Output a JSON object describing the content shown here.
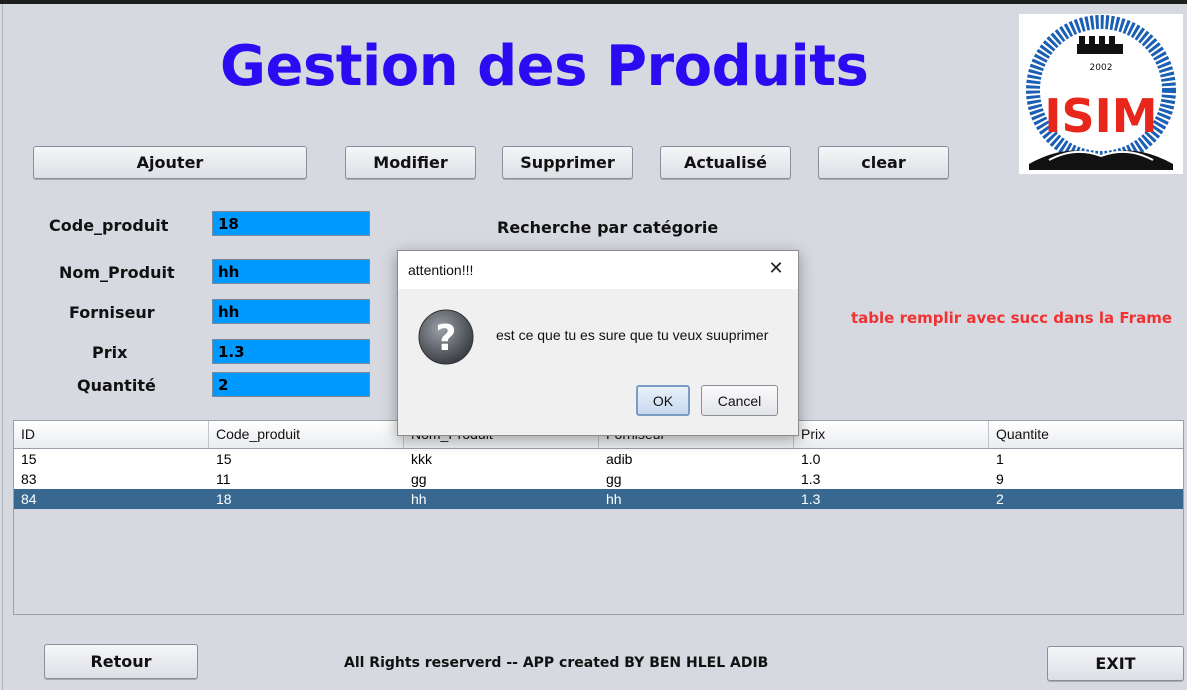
{
  "app": {
    "title": "Gestion des Produits"
  },
  "logo": {
    "text": "ISIM",
    "year": "2002"
  },
  "toolbar": {
    "ajouter": "Ajouter",
    "modifier": "Modifier",
    "supprimer": "Supprimer",
    "actualise": "Actualisé",
    "clear": "clear"
  },
  "form": {
    "code_label": "Code_produit",
    "code_value": "18",
    "nom_label": "Nom_Produit",
    "nom_value": "hh",
    "fournisseur_label": "Forniseur",
    "fournisseur_value": "hh",
    "prix_label": "Prix",
    "prix_value": "1.3",
    "quantite_label": "Quantité",
    "quantite_value": "2"
  },
  "search": {
    "label": "Recherche par catégorie"
  },
  "status": {
    "text": "table remplir avec succ dans la Frame",
    "color": "#f03232"
  },
  "table": {
    "columns": [
      "ID",
      "Code_produit",
      "Nom_Produit",
      "Forniseur",
      "Prix",
      "Quantite"
    ],
    "rows": [
      [
        "15",
        "15",
        "kkk",
        "adib",
        "1.0",
        "1"
      ],
      [
        "83",
        "11",
        "gg",
        "gg",
        "1.3",
        "9"
      ],
      [
        "84",
        "18",
        "hh",
        "hh",
        "1.3",
        "2"
      ]
    ],
    "selected_row": 2
  },
  "footer": {
    "retour": "Retour",
    "credits": "All Rights reserverd -- APP created BY BEN HLEL ADIB",
    "exit": "EXIT"
  },
  "dialog": {
    "title": "attention!!!",
    "message": "est ce que tu es sure que tu veux suuprimer",
    "ok": "OK",
    "cancel": "Cancel",
    "icon": "question-icon"
  },
  "colors": {
    "accent_title": "#2a0cf2",
    "field_bg": "#0099ff",
    "selection": "#386890"
  }
}
